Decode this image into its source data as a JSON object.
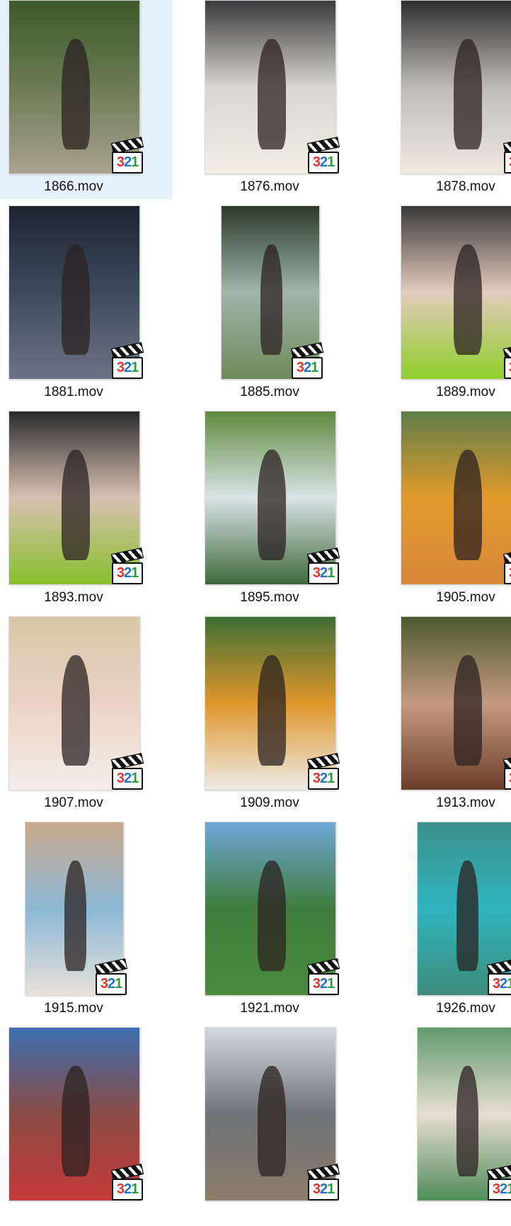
{
  "files": [
    {
      "name": "1866.mov",
      "selected": true,
      "colors": [
        "#3d5a2c",
        "#6b7b55",
        "#a9a38f"
      ]
    },
    {
      "name": "1876.mov",
      "colors": [
        "#3a3a3c",
        "#d8d6cf",
        "#f2eee6"
      ]
    },
    {
      "name": "1878.mov",
      "colors": [
        "#2f2f31",
        "#bfbcb6",
        "#efebe3"
      ]
    },
    {
      "name": "1881.mov",
      "colors": [
        "#1c2430",
        "#3e4a5c",
        "#6c7484"
      ]
    },
    {
      "name": "1885.mov",
      "colors": [
        "#2d3a2a",
        "#9fb6a9",
        "#6e8a5a"
      ]
    },
    {
      "name": "1889.mov",
      "colors": [
        "#3b3a3a",
        "#e3cbbd",
        "#8fcf2a"
      ]
    },
    {
      "name": "1893.mov",
      "colors": [
        "#2a2a2c",
        "#d9c1b2",
        "#86c02c"
      ]
    },
    {
      "name": "1895.mov",
      "colors": [
        "#5e8a3e",
        "#d9e4e6",
        "#3f6a3a"
      ]
    },
    {
      "name": "1905.mov",
      "colors": [
        "#5e7d4a",
        "#e39a2a",
        "#d8873a"
      ]
    },
    {
      "name": "1907.mov",
      "colors": [
        "#d8c7a8",
        "#ecd2c5",
        "#f3efe9"
      ]
    },
    {
      "name": "1909.mov",
      "colors": [
        "#3f6f35",
        "#e0962b",
        "#ecebe6"
      ]
    },
    {
      "name": "1913.mov",
      "colors": [
        "#4d5a2f",
        "#c59a80",
        "#6a3e28"
      ]
    },
    {
      "name": "1915.mov",
      "colors": [
        "#c9a98c",
        "#8cb8d6",
        "#e7e1d9"
      ]
    },
    {
      "name": "1921.mov",
      "colors": [
        "#6fa6d8",
        "#3e7d3c",
        "#4a8a3e"
      ]
    },
    {
      "name": "1926.mov",
      "colors": [
        "#3c8f8a",
        "#2fb5c0",
        "#3e8b7a"
      ]
    },
    {
      "name": "",
      "colors": [
        "#3d6fb0",
        "#8a4b44",
        "#c63a3a"
      ]
    },
    {
      "name": "",
      "colors": [
        "#d4d9df",
        "#6e7378",
        "#8c7b6a"
      ]
    },
    {
      "name": "",
      "colors": [
        "#5f9a6a",
        "#e8ddd3",
        "#4f8d59"
      ]
    }
  ]
}
